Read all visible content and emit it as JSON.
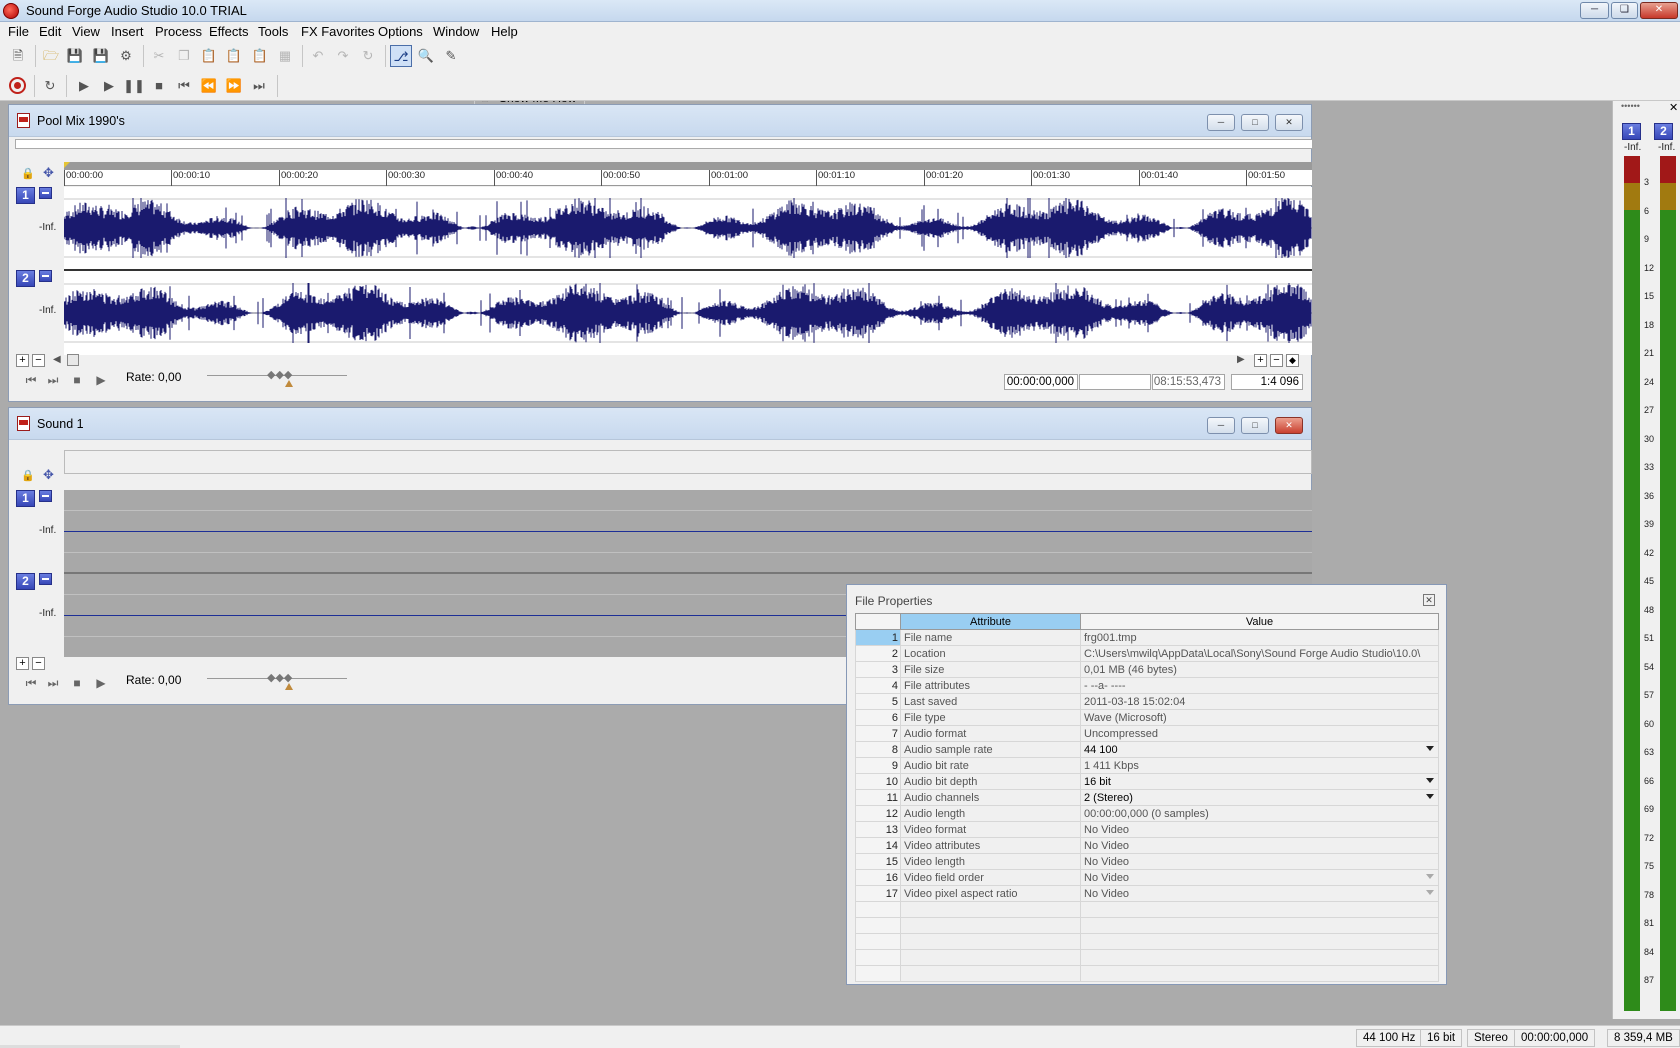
{
  "app": {
    "title": "Sound Forge Audio Studio 10.0 TRIAL"
  },
  "menu": [
    "File",
    "Edit",
    "View",
    "Insert",
    "Process",
    "Effects",
    "Tools",
    "FX Favorites",
    "Options",
    "Window",
    "Help"
  ],
  "toolbar": {
    "show_me_how": "Show Me How"
  },
  "window1": {
    "title": "Pool Mix 1990's",
    "ruler": [
      "00:00:00",
      "00:00:10",
      "00:00:20",
      "00:00:30",
      "00:00:40",
      "00:00:50",
      "00:01:00",
      "00:01:10",
      "00:01:20",
      "00:01:30",
      "00:01:40",
      "00:01:50"
    ],
    "channels": [
      {
        "num": "1",
        "level": "-Inf."
      },
      {
        "num": "2",
        "level": "-Inf."
      }
    ],
    "rate": "Rate: 0,00",
    "position": "00:00:00,000",
    "length": "08:15:53,473",
    "zoom": "1:4 096"
  },
  "window2": {
    "title": "Sound 1",
    "channels": [
      {
        "num": "1",
        "level": "-Inf."
      },
      {
        "num": "2",
        "level": "-Inf."
      }
    ],
    "rate": "Rate: 0,00"
  },
  "file_properties": {
    "title": "File Properties",
    "headers": {
      "attribute": "Attribute",
      "value": "Value"
    },
    "rows": [
      {
        "num": "1",
        "attr": "File name",
        "value": "frg001.tmp"
      },
      {
        "num": "2",
        "attr": "Location",
        "value": "C:\\Users\\mwilq\\AppData\\Local\\Sony\\Sound Forge Audio Studio\\10.0\\"
      },
      {
        "num": "3",
        "attr": "File size",
        "value": "0,01 MB (46 bytes)"
      },
      {
        "num": "4",
        "attr": "File attributes",
        "value": "- --a- ----"
      },
      {
        "num": "5",
        "attr": "Last saved",
        "value": "2011-03-18  15:02:04"
      },
      {
        "num": "6",
        "attr": "File type",
        "value": "Wave (Microsoft)"
      },
      {
        "num": "7",
        "attr": "Audio format",
        "value": "Uncompressed"
      },
      {
        "num": "8",
        "attr": "Audio sample rate",
        "value": "44 100"
      },
      {
        "num": "9",
        "attr": "Audio bit rate",
        "value": "1 411 Kbps"
      },
      {
        "num": "10",
        "attr": "Audio bit depth",
        "value": "16 bit"
      },
      {
        "num": "11",
        "attr": "Audio channels",
        "value": "2  (Stereo)"
      },
      {
        "num": "12",
        "attr": "Audio length",
        "value": "00:00:00,000 (0 samples)"
      },
      {
        "num": "13",
        "attr": "Video format",
        "value": "No Video"
      },
      {
        "num": "14",
        "attr": "Video attributes",
        "value": "No Video"
      },
      {
        "num": "15",
        "attr": "Video length",
        "value": "No Video"
      },
      {
        "num": "16",
        "attr": "Video field order",
        "value": "No Video"
      },
      {
        "num": "17",
        "attr": "Video pixel aspect ratio",
        "value": "No Video"
      }
    ]
  },
  "meter": {
    "channels": [
      "1",
      "2"
    ],
    "peak": "-Inf.",
    "scale": [
      "3",
      "6",
      "9",
      "12",
      "15",
      "18",
      "21",
      "24",
      "27",
      "30",
      "33",
      "36",
      "39",
      "42",
      "45",
      "48",
      "51",
      "54",
      "57",
      "60",
      "63",
      "66",
      "69",
      "72",
      "75",
      "78",
      "81",
      "84",
      "87"
    ]
  },
  "status": {
    "sample_rate": "44 100 Hz",
    "bit_depth": "16 bit",
    "channels": "Stereo",
    "time": "00:00:00,000",
    "free": "8 359,4 MB"
  }
}
